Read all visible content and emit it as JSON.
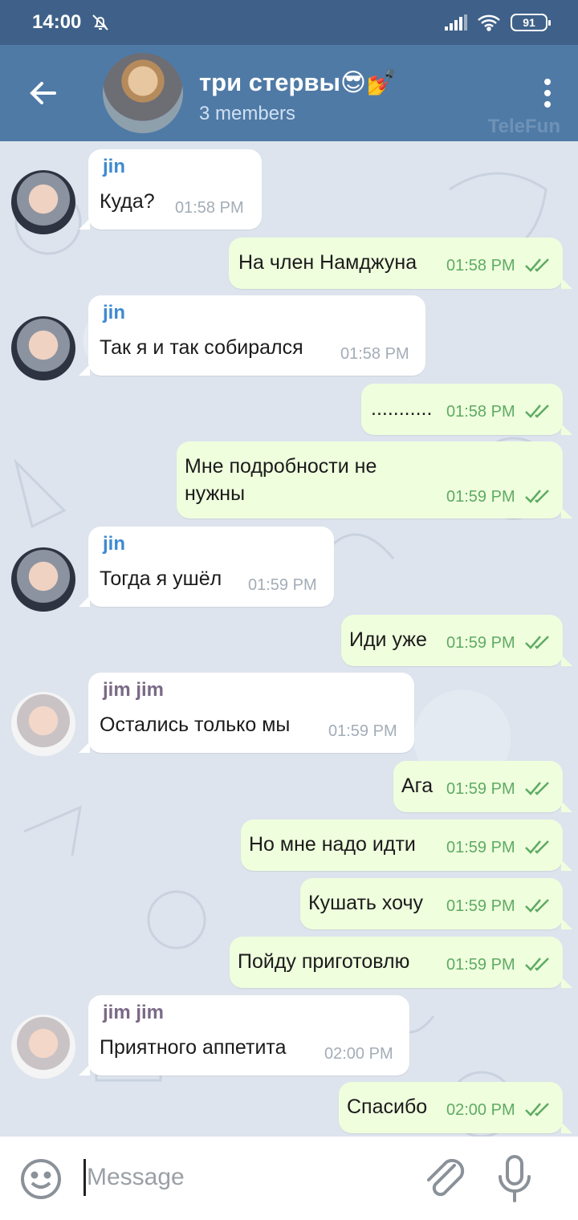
{
  "status_bar": {
    "time": "14:00",
    "battery": "91"
  },
  "header": {
    "title": "три стервы😎💅",
    "subtitle": "3 members",
    "watermark": "TeleFun"
  },
  "messages": [
    {
      "dir": "in",
      "sender": "jin",
      "text": "Куда?",
      "time": "01:58 PM"
    },
    {
      "dir": "out",
      "text": "На член Намджуна",
      "time": "01:58 PM"
    },
    {
      "dir": "in",
      "sender": "jin",
      "text": "Так я и так собирался",
      "time": "01:58 PM"
    },
    {
      "dir": "out",
      "text": "...........",
      "time": "01:58 PM"
    },
    {
      "dir": "out",
      "text_line1": "Мне подробности не",
      "text_line2": "нужны",
      "time": "01:59 PM"
    },
    {
      "dir": "in",
      "sender": "jin",
      "text": "Тогда я ушёл",
      "time": "01:59 PM"
    },
    {
      "dir": "out",
      "text": "Иди уже",
      "time": "01:59 PM"
    },
    {
      "dir": "in",
      "sender": "jim jim",
      "text": "Остались только мы",
      "time": "01:59 PM"
    },
    {
      "dir": "out",
      "text": "Ага",
      "time": "01:59 PM"
    },
    {
      "dir": "out",
      "text": "Но мне надо идти",
      "time": "01:59 PM"
    },
    {
      "dir": "out",
      "text": "Кушать хочу",
      "time": "01:59 PM"
    },
    {
      "dir": "out",
      "text": "Пойду приготовлю",
      "time": "01:59 PM"
    },
    {
      "dir": "in",
      "sender": "jim jim",
      "text": "Приятного аппетита",
      "time": "02:00 PM"
    },
    {
      "dir": "out",
      "text": "Спасибо",
      "time": "02:00 PM"
    }
  ],
  "input": {
    "placeholder": "Message"
  },
  "colors": {
    "header": "#4f7aa6",
    "status_bar": "#3f6189",
    "outgoing": "#effedd",
    "incoming": "#ffffff",
    "check": "#5eab63"
  }
}
